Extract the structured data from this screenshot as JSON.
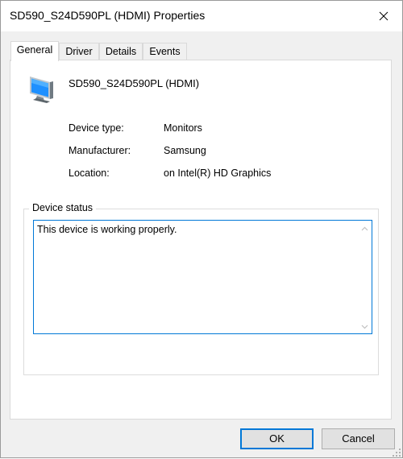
{
  "window": {
    "title": "SD590_S24D590PL (HDMI) Properties",
    "close_icon": "close-icon"
  },
  "tabs": [
    {
      "label": "General",
      "active": true
    },
    {
      "label": "Driver",
      "active": false
    },
    {
      "label": "Details",
      "active": false
    },
    {
      "label": "Events",
      "active": false
    }
  ],
  "general": {
    "device_icon": "monitor-icon",
    "device_name": "SD590_S24D590PL (HDMI)",
    "properties": [
      {
        "label": "Device type:",
        "value": "Monitors"
      },
      {
        "label": "Manufacturer:",
        "value": "Samsung"
      },
      {
        "label": "Location:",
        "value": "on Intel(R) HD Graphics"
      }
    ],
    "status_group_label": "Device status",
    "status_text": "This device is working properly."
  },
  "buttons": {
    "ok_label": "OK",
    "cancel_label": "Cancel"
  },
  "colors": {
    "accent": "#0078d7",
    "monitor_screen": "#1e90ff"
  }
}
